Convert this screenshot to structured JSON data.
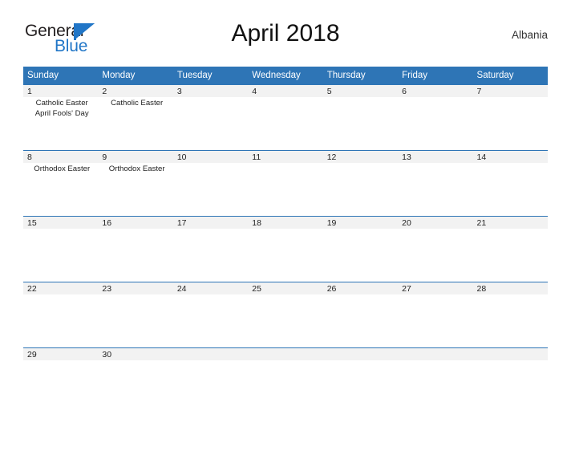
{
  "brand": {
    "name_part1": "General",
    "name_part2": "Blue",
    "flag_icon": "blue-triangle-flag",
    "colors": {
      "dark": "#231f20",
      "blue": "#2176c7"
    }
  },
  "header": {
    "title": "April 2018",
    "region": "Albania"
  },
  "calendar": {
    "accent_color": "#2e75b6",
    "band_color": "#f2f2f2",
    "weekday_headers": [
      "Sunday",
      "Monday",
      "Tuesday",
      "Wednesday",
      "Thursday",
      "Friday",
      "Saturday"
    ],
    "weeks": [
      {
        "days": [
          {
            "num": "1",
            "events": [
              "Catholic Easter",
              "April Fools' Day"
            ]
          },
          {
            "num": "2",
            "events": [
              "Catholic Easter"
            ]
          },
          {
            "num": "3",
            "events": []
          },
          {
            "num": "4",
            "events": []
          },
          {
            "num": "5",
            "events": []
          },
          {
            "num": "6",
            "events": []
          },
          {
            "num": "7",
            "events": []
          }
        ]
      },
      {
        "days": [
          {
            "num": "8",
            "events": [
              "Orthodox Easter"
            ]
          },
          {
            "num": "9",
            "events": [
              "Orthodox Easter"
            ]
          },
          {
            "num": "10",
            "events": []
          },
          {
            "num": "11",
            "events": []
          },
          {
            "num": "12",
            "events": []
          },
          {
            "num": "13",
            "events": []
          },
          {
            "num": "14",
            "events": []
          }
        ]
      },
      {
        "days": [
          {
            "num": "15",
            "events": []
          },
          {
            "num": "16",
            "events": []
          },
          {
            "num": "17",
            "events": []
          },
          {
            "num": "18",
            "events": []
          },
          {
            "num": "19",
            "events": []
          },
          {
            "num": "20",
            "events": []
          },
          {
            "num": "21",
            "events": []
          }
        ]
      },
      {
        "days": [
          {
            "num": "22",
            "events": []
          },
          {
            "num": "23",
            "events": []
          },
          {
            "num": "24",
            "events": []
          },
          {
            "num": "25",
            "events": []
          },
          {
            "num": "26",
            "events": []
          },
          {
            "num": "27",
            "events": []
          },
          {
            "num": "28",
            "events": []
          }
        ]
      },
      {
        "days": [
          {
            "num": "29",
            "events": []
          },
          {
            "num": "30",
            "events": []
          },
          {
            "num": "",
            "events": []
          },
          {
            "num": "",
            "events": []
          },
          {
            "num": "",
            "events": []
          },
          {
            "num": "",
            "events": []
          },
          {
            "num": "",
            "events": []
          }
        ]
      }
    ]
  }
}
